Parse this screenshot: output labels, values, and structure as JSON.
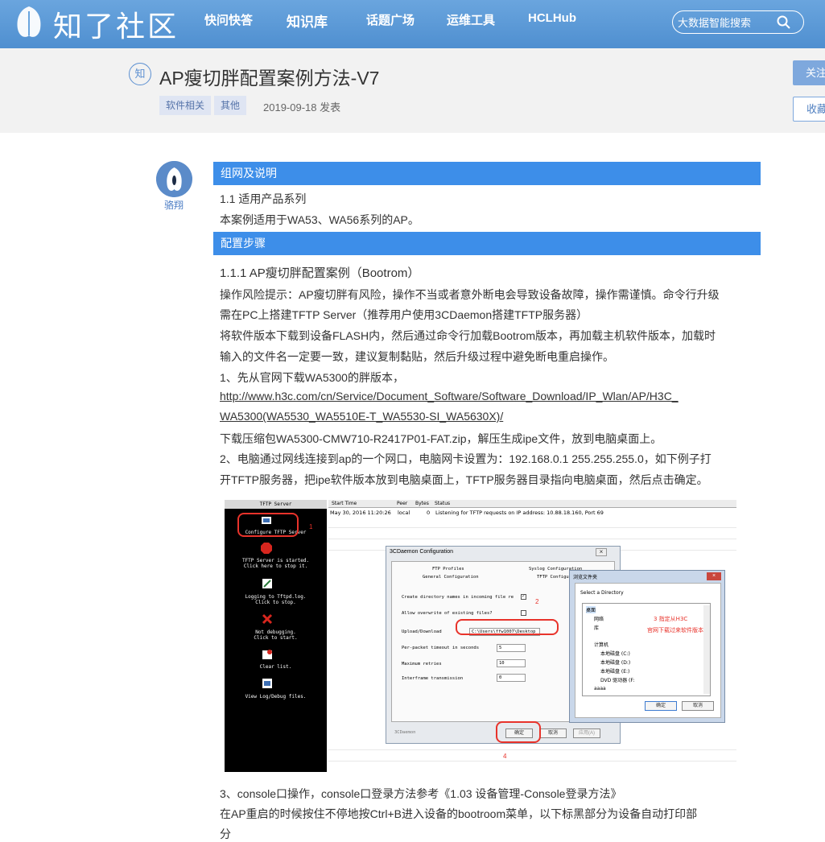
{
  "site": {
    "logo_text": "知了社区",
    "nav": [
      "快问快答",
      "知识库",
      "话题广场",
      "运维工具",
      "HCLHub"
    ],
    "search_placeholder": "大数据智能搜索",
    "brand_color": "#4f8fd0"
  },
  "article": {
    "badge": "知",
    "title": "AP瘦切胖配置案例方法-V7",
    "tags": [
      "软件相关",
      "其他"
    ],
    "date": "2019-09-18 发表",
    "follow_label": "关注",
    "favorite_label": "收藏",
    "author": "骆翔"
  },
  "content": {
    "section1": "组网及说明",
    "s1_l1": "1.1  适用产品系列",
    "s1_l2": "本案例适用于WA53、WA56系列的AP。",
    "section2": "配置步骤",
    "s2_h": "1.1.1  AP瘦切胖配置案例（Bootrom）",
    "p1": "操作风险提示：AP瘦切胖有风险，操作不当或者意外断电会导致设备故障，操作需谨慎。命令行升级",
    "p2": "需在PC上搭建TFTP Server（推荐用户使用3CDaemon搭建TFTP服务器）",
    "p3": "将软件版本下载到设备FLASH内，然后通过命令行加载Bootrom版本，再加载主机软件版本，加载时",
    "p4": "输入的文件名一定要一致，建议复制黏贴，然后升级过程中避免断电重启操作。",
    "p5": "1、先从官网下载WA5300的胖版本，",
    "link1": "http://www.h3c.com/cn/Service/Document_Software/Software_Download/IP_Wlan/AP/H3C_",
    "link2": "WA5300(WA5530_WA5510E-T_WA5530-SI_WA5630X)/",
    "p6": "下载压缩包WA5300-CMW710-R2417P01-FAT.zip，解压生成ipe文件，放到电脑桌面上。",
    "p7": "2、电脑通过网线连接到ap的一个网口，电脑网卡设置为：192.168.0.1 255.255.255.0，如下例子打",
    "p8": "开TFTP服务器，把ipe软件版本放到电脑桌面上，TFTP服务器目录指向电脑桌面，然后点击确定。",
    "p9": "3、console口操作，console口登录方法参考《1.03 设备管理-Console登录方法》",
    "p10": "在AP重启的时候按住不停地按Ctrl+B进入设备的bootroom菜单，以下标黑部分为设备自动打印部",
    "p11": "分"
  },
  "screenshot": {
    "left_title": "TFTP Server",
    "items": [
      "Configure TFTP Server",
      "TFTP Server is started.",
      "Click here to stop it.",
      "Logging to Tftpd.log.",
      "Click to stop.",
      "Not debugging.",
      "Click to start.",
      "Clear list.",
      "View Log/Debug files."
    ],
    "grid_headers": [
      "Start Time",
      "Peer",
      "Bytes",
      "Status"
    ],
    "grid_row": [
      "May 30, 2016 11:20:26",
      "local",
      "0",
      "Listening for TFTP requests on IP address: 10.88.18.160, Port 69"
    ],
    "dlg_title": "3CDaemon Configuration",
    "dlg_tabs": [
      "FTP Profiles",
      "Syslog Configuration",
      "General Configuration",
      "TFTP Configuration"
    ],
    "dlg_rows": [
      "Create directory names in incoming file re",
      "Allow overwrite of existing files?",
      "Upload/Download",
      "Per-packet timeout in seconds",
      "Maximum retries",
      "Interframe transmission"
    ],
    "dlg_values": [
      "C:\\Users\\ffw1007\\Desktop",
      "5",
      "10",
      "0"
    ],
    "dlg_buttons": [
      "确定",
      "取消",
      "应用(A)"
    ],
    "dlg_footer": "3CDaemon",
    "browse_title": "浏览文件夹",
    "browse_prompt": "Select a Directory",
    "browse_tree": [
      "桌面",
      "网络",
      "库",
      "计算机",
      "本地磁盘 (C:)",
      "本地磁盘 (D:)",
      "本地磁盘 (E:)",
      "DVD 驱动器 (F:",
      "aaaa"
    ],
    "browse_buttons": [
      "确定",
      "取消"
    ],
    "note1": "3 指定从H3C",
    "note2": "官网下载过来软件版本",
    "markers": [
      "1",
      "2",
      "3",
      "4"
    ]
  }
}
